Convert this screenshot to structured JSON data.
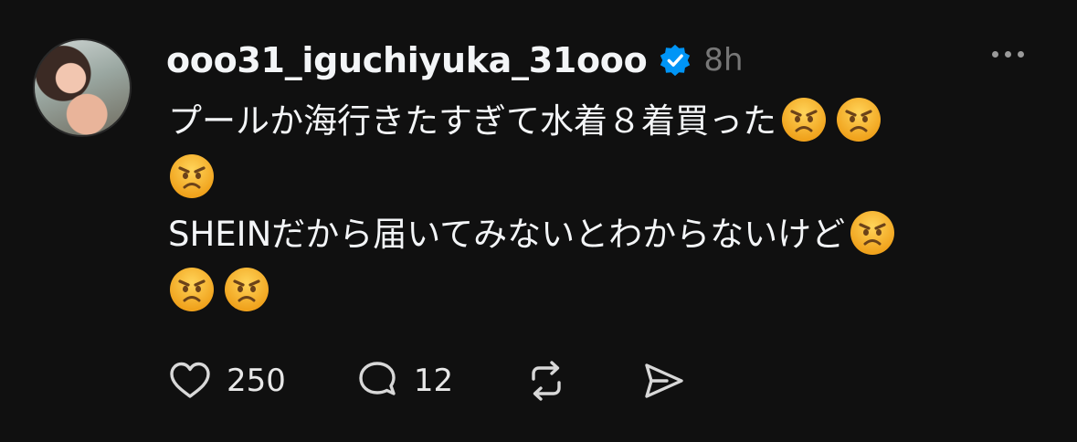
{
  "post": {
    "username": "ooo31_iguchiyuka_31ooo",
    "verified": true,
    "time": "8h",
    "text_line1": "プールか海行きたすぎて水着８着買った",
    "text_line2": "SHEINだから届いてみないとわからないけど",
    "emoji_name": "angry-face"
  },
  "actions": {
    "like_count": "250",
    "reply_count": "12",
    "icons": [
      "heart-icon",
      "comment-icon",
      "repost-icon",
      "share-icon"
    ]
  },
  "colors": {
    "background": "#101010",
    "text": "#f3f5f7",
    "muted": "#777777",
    "verified": "#0095f6",
    "emoji_face": "#f5b52d",
    "emoji_feature": "#6b4219"
  }
}
